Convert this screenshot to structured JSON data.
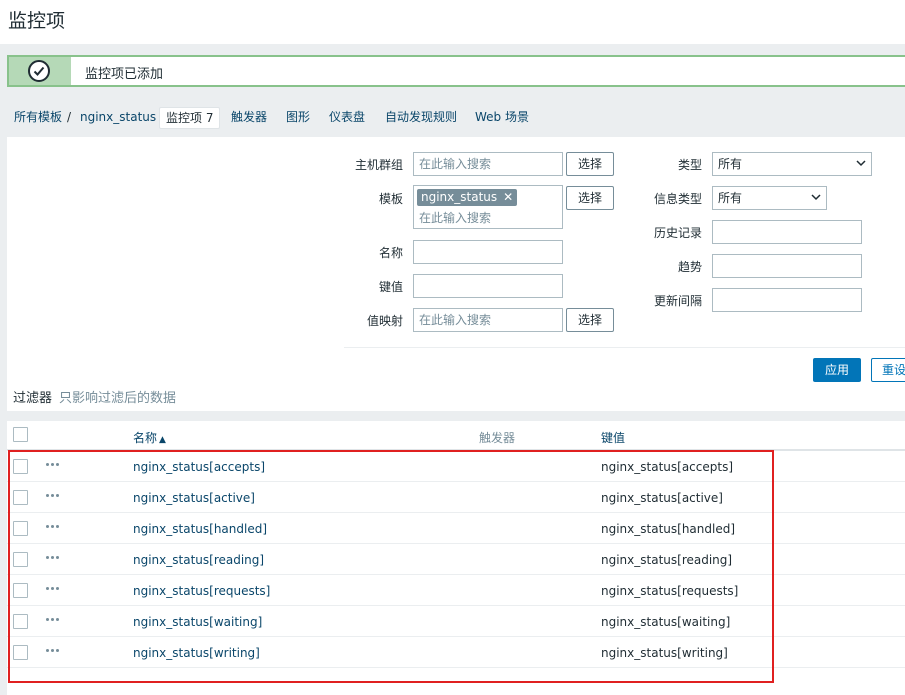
{
  "page": {
    "title": "监控项"
  },
  "message": {
    "text": "监控项已添加",
    "icon": "check-circle-icon"
  },
  "breadcrumbs": {
    "all_templates": "所有模板",
    "separator": "/",
    "template": "nginx_status",
    "items_tab": "监控项 7",
    "triggers_tab": "触发器",
    "graphs_tab": "图形",
    "dashboards_tab": "仪表盘",
    "discovery_tab": "自动发现规则",
    "web_tab": "Web 场景"
  },
  "filter": {
    "host_groups": {
      "label": "主机群组",
      "placeholder": "在此输入搜索",
      "button": "选择"
    },
    "templates": {
      "label": "模板",
      "tag": "nginx_status",
      "placeholder": "在此输入搜索",
      "button": "选择"
    },
    "name": {
      "label": "名称",
      "value": ""
    },
    "key": {
      "label": "键值",
      "value": ""
    },
    "value_map": {
      "label": "值映射",
      "placeholder": "在此输入搜索",
      "button": "选择"
    },
    "type": {
      "label": "类型",
      "selected": "所有"
    },
    "info_type": {
      "label": "信息类型",
      "selected": "所有"
    },
    "history": {
      "label": "历史记录",
      "value": ""
    },
    "trends": {
      "label": "趋势",
      "value": ""
    },
    "interval": {
      "label": "更新间隔",
      "value": ""
    },
    "apply_label": "应用",
    "reset_label": "重设",
    "title": "过滤器",
    "subtitle": "只影响过滤后的数据"
  },
  "table": {
    "headers": {
      "name": "名称",
      "sort_arrow": "▲",
      "triggers": "触发器",
      "key": "键值"
    },
    "rows": [
      {
        "name": "nginx_status[accepts]",
        "key": "nginx_status[accepts]"
      },
      {
        "name": "nginx_status[active]",
        "key": "nginx_status[active]"
      },
      {
        "name": "nginx_status[handled]",
        "key": "nginx_status[handled]"
      },
      {
        "name": "nginx_status[reading]",
        "key": "nginx_status[reading]"
      },
      {
        "name": "nginx_status[requests]",
        "key": "nginx_status[requests]"
      },
      {
        "name": "nginx_status[waiting]",
        "key": "nginx_status[waiting]"
      },
      {
        "name": "nginx_status[writing]",
        "key": "nginx_status[writing]"
      }
    ]
  },
  "colors": {
    "link": "#0a466a",
    "accent": "#0275b8",
    "success_border": "#88c28b",
    "highlight": "#e02020"
  }
}
